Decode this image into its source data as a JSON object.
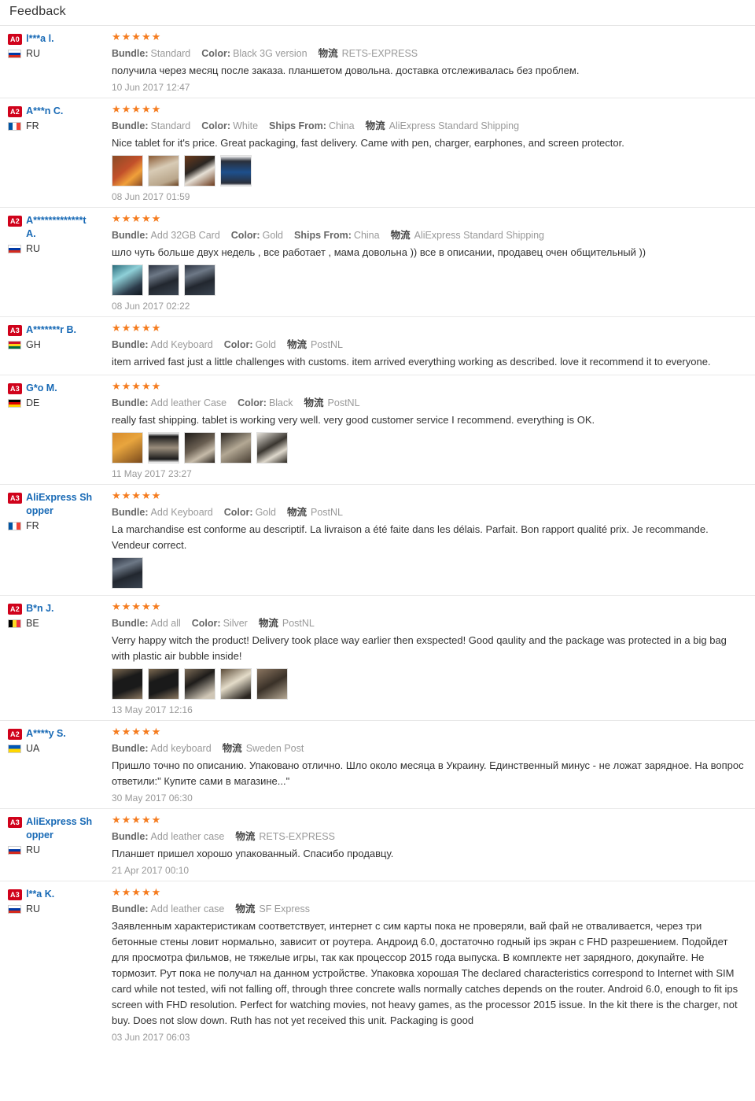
{
  "page": {
    "title": "Feedback"
  },
  "labels": {
    "bundle": "Bundle:",
    "color": "Color:",
    "ships_from": "Ships From:",
    "logistics_mark": "物流",
    "stars": "★★★★★"
  },
  "reviews": [
    {
      "level": "A0",
      "name": "l***a l.",
      "country": "RU",
      "flag_class": "flag-ru",
      "stars": "★★★★★",
      "attrs": [
        {
          "key": "Bundle:",
          "value": "Standard"
        },
        {
          "key": "Color:",
          "value": "Black 3G version"
        }
      ],
      "logistics": "RETS-EXPRESS",
      "comment": "получила через месяц после заказа. планшетом довольна. доставка отслеживалась без проблем.",
      "thumbs": [],
      "date": "10 Jun 2017 12:47"
    },
    {
      "level": "A2",
      "name": "A***n C.",
      "country": "FR",
      "flag_class": "flag-fr",
      "stars": "★★★★★",
      "attrs": [
        {
          "key": "Bundle:",
          "value": "Standard"
        },
        {
          "key": "Color:",
          "value": "White"
        },
        {
          "key": "Ships From:",
          "value": "China"
        }
      ],
      "logistics": "AliExpress Standard Shipping",
      "comment": "Nice tablet for it's price. Great packaging, fast delivery. Came with pen, charger, earphones, and screen protector.",
      "thumbs": [
        "t-a",
        "t-b",
        "t-c",
        "t-d"
      ],
      "date": "08 Jun 2017 01:59"
    },
    {
      "level": "A2",
      "name": "A*************t A.",
      "country": "RU",
      "flag_class": "flag-ru",
      "stars": "★★★★★",
      "attrs": [
        {
          "key": "Bundle:",
          "value": "Add 32GB Card"
        },
        {
          "key": "Color:",
          "value": "Gold"
        },
        {
          "key": "Ships From:",
          "value": "China"
        }
      ],
      "logistics": "AliExpress Standard Shipping",
      "comment": "шло чуть больше двух недель , все работает , мама довольна )) все в описании, продавец очен общительный ))",
      "thumbs": [
        "t-e",
        "t-f",
        "t-f"
      ],
      "date": "08 Jun 2017 02:22"
    },
    {
      "level": "A3",
      "name": "A*******r B.",
      "country": "GH",
      "flag_class": "flag-gh",
      "stars": "★★★★★",
      "attrs": [
        {
          "key": "Bundle:",
          "value": "Add Keyboard"
        },
        {
          "key": "Color:",
          "value": "Gold"
        }
      ],
      "logistics": "PostNL",
      "comment": "item arrived fast just a little challenges with customs. item arrived everything working as described. love it recommend it to everyone.",
      "thumbs": [],
      "date": ""
    },
    {
      "level": "A3",
      "name": "G*o M.",
      "country": "DE",
      "flag_class": "flag-de",
      "stars": "★★★★★",
      "attrs": [
        {
          "key": "Bundle:",
          "value": "Add leather Case"
        },
        {
          "key": "Color:",
          "value": "Black"
        }
      ],
      "logistics": "PostNL",
      "comment": "really fast shipping. tablet is working very well. very good customer service I recommend. everything is OK.",
      "thumbs": [
        "t-g",
        "t-h",
        "t-i",
        "t-j",
        "t-k"
      ],
      "date": "11 May 2017 23:27"
    },
    {
      "level": "A3",
      "name": "AliExpress Shopper",
      "country": "FR",
      "flag_class": "flag-fr",
      "stars": "★★★★★",
      "attrs": [
        {
          "key": "Bundle:",
          "value": "Add Keyboard"
        },
        {
          "key": "Color:",
          "value": "Gold"
        }
      ],
      "logistics": "PostNL",
      "comment": "La marchandise est conforme au descriptif. La livraison a été faite dans les délais. Parfait. Bon rapport qualité prix. Je recommande. Vendeur correct.",
      "thumbs": [
        "t-f"
      ],
      "date": ""
    },
    {
      "level": "A2",
      "name": "B*n J.",
      "country": "BE",
      "flag_class": "flag-be",
      "stars": "★★★★★",
      "attrs": [
        {
          "key": "Bundle:",
          "value": "Add  all"
        },
        {
          "key": "Color:",
          "value": "Silver"
        }
      ],
      "logistics": "PostNL",
      "comment": "Verry happy witch the product! Delivery took place way earlier then exspected! Good qaulity and the package was protected in a big bag with plastic air bubble inside!",
      "thumbs": [
        "t-m",
        "t-m",
        "t-l",
        "t-n",
        "t-p"
      ],
      "date": "13 May 2017 12:16"
    },
    {
      "level": "A2",
      "name": "A****y S.",
      "country": "UA",
      "flag_class": "flag-ua",
      "stars": "★★★★★",
      "attrs": [
        {
          "key": "Bundle:",
          "value": "Add keyboard"
        }
      ],
      "logistics": "Sweden Post",
      "comment": "Пришло точно по описанию. Упаковано отлично. Шло около месяца в Украину. Единственный минус - не ложат зарядное. На вопрос ответили:\" Купите сами в магазине...\"",
      "thumbs": [],
      "date": "30 May 2017 06:30"
    },
    {
      "level": "A3",
      "name": "AliExpress Shopper",
      "country": "RU",
      "flag_class": "flag-ru",
      "stars": "★★★★★",
      "attrs": [
        {
          "key": "Bundle:",
          "value": "Add leather case"
        }
      ],
      "logistics": "RETS-EXPRESS",
      "comment": "Планшет пришел хорошо упакованный. Спасибо продавцу.",
      "thumbs": [],
      "date": "21 Apr 2017 00:10"
    },
    {
      "level": "A3",
      "name": "l**a K.",
      "country": "RU",
      "flag_class": "flag-ru",
      "stars": "★★★★★",
      "attrs": [
        {
          "key": "Bundle:",
          "value": "Add leather case"
        }
      ],
      "logistics": "SF Express",
      "comment": "Заявленным характеристикам соответствует, интернет с сим карты пока не проверяли, вай фай не отваливается, через три бетонные стены ловит нормально, зависит от роутера. Андроид 6.0, достаточно годный ips экран с FHD разрешением. Подойдет для просмотра фильмов, не тяжелые игры, так как процессор 2015 года выпуска. В комплекте нет зарядного, докупайте. Не тормозит. Рут пока не получал на данном устройстве. Упаковка хорошая The declared characteristics correspond to Internet with SIM card while not tested, wifi not falling off, through three concrete walls normally catches depends on the router. Android 6.0, enough to fit ips screen with FHD resolution. Perfect for watching movies, not heavy games, as the processor 2015 issue. In the kit there is the charger, not buy. Does not slow down. Ruth has not yet received this unit. Packaging is good",
      "thumbs": [],
      "date": "03 Jun 2017 06:03"
    }
  ]
}
